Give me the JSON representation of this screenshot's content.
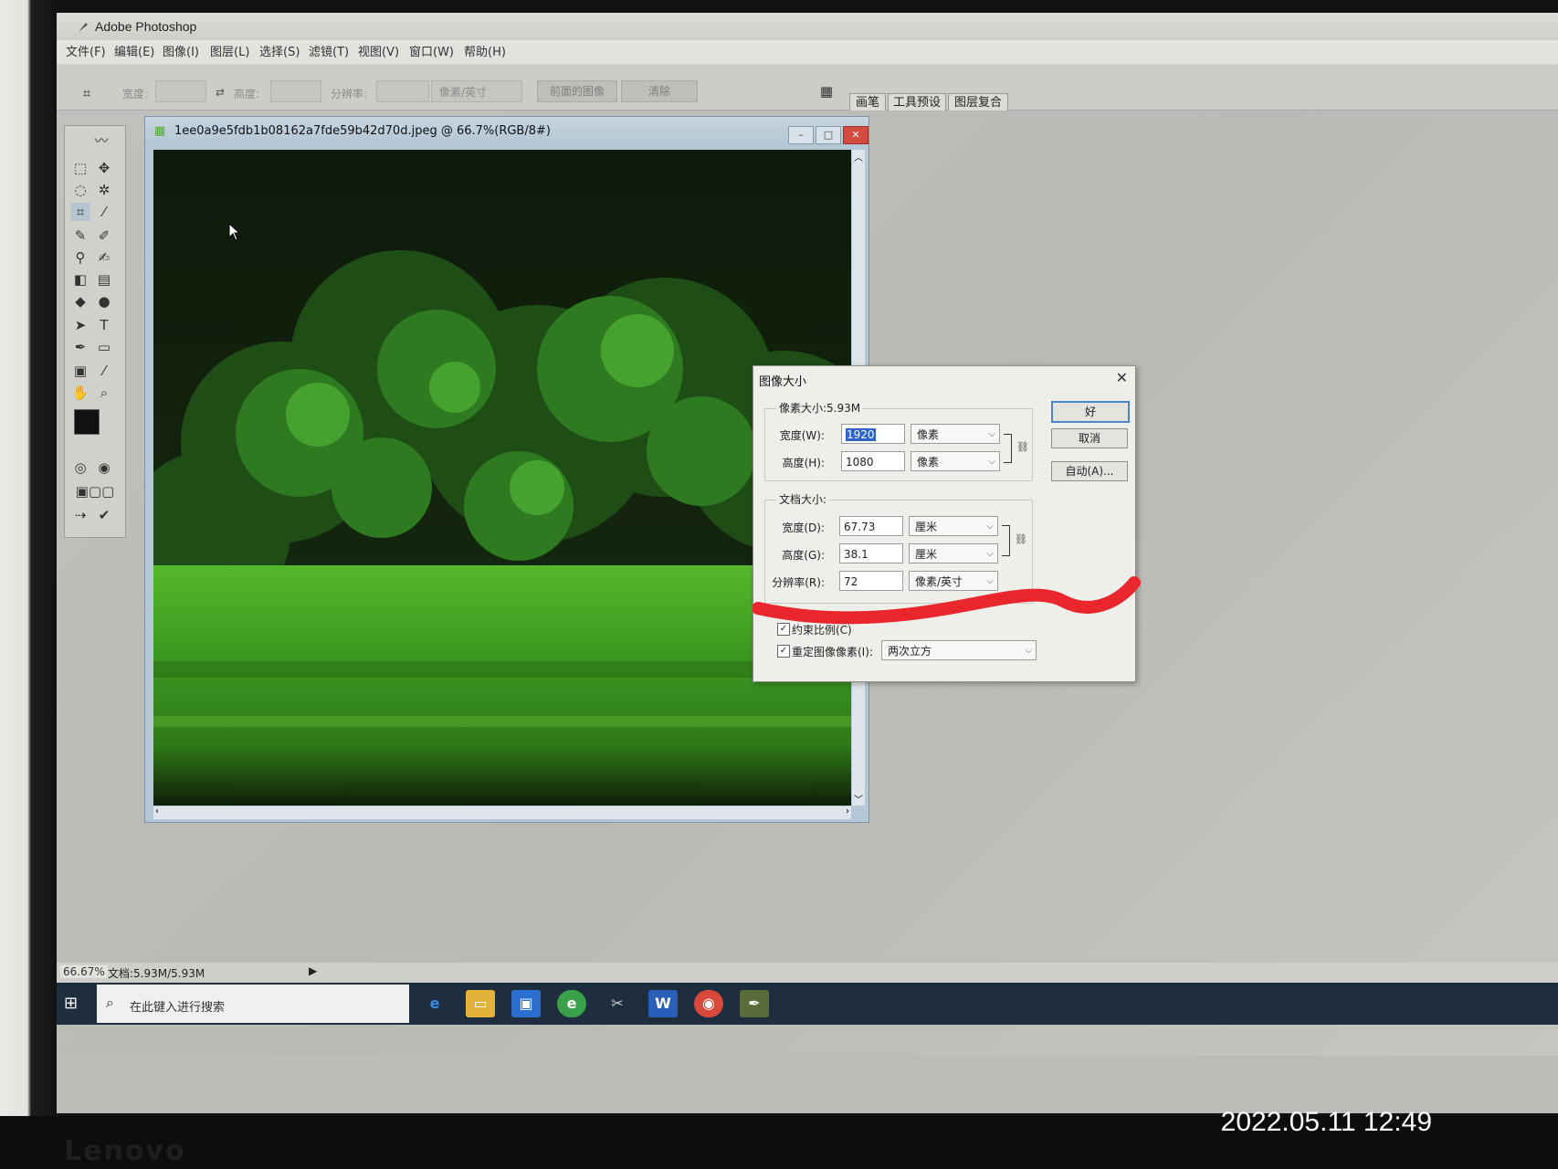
{
  "app": {
    "title": "Adobe Photoshop"
  },
  "menu": [
    "文件(F)",
    "编辑(E)",
    "图像(I)",
    "图层(L)",
    "选择(S)",
    "滤镜(T)",
    "视图(V)",
    "窗口(W)",
    "帮助(H)"
  ],
  "options": {
    "width_label": "宽度:",
    "height_label": "高度:",
    "resolution_label": "分辨率:",
    "unit_select": "像素/英寸",
    "front_image_button": "前面的图像",
    "clear_button": "清除"
  },
  "palette_tabs": [
    "画笔",
    "工具预设",
    "图层复合"
  ],
  "document": {
    "title": "1ee0a9e5fdb1b08162a7fde59b42d70d.jpeg @ 66.7%(RGB/8#)"
  },
  "dialog": {
    "title": "图像大小",
    "pixel_dimensions_label": "像素大小:5.93M",
    "width_label": "宽度(W):",
    "width_value": "1920",
    "width_unit": "像素",
    "height_label": "高度(H):",
    "height_value": "1080",
    "height_unit": "像素",
    "document_size_label": "文档大小:",
    "doc_width_label": "宽度(D):",
    "doc_width_value": "67.73",
    "doc_width_unit": "厘米",
    "doc_height_label": "高度(G):",
    "doc_height_value": "38.1",
    "doc_height_unit": "厘米",
    "resolution_label": "分辨率(R):",
    "resolution_value": "72",
    "resolution_unit": "像素/英寸",
    "constrain_label": "约束比例(C)",
    "constrain_checked": true,
    "resample_label": "重定图像像素(I):",
    "resample_checked": true,
    "resample_method": "两次立方",
    "ok_button": "好",
    "cancel_button": "取消",
    "auto_button": "自动(A)..."
  },
  "status": {
    "zoom": "66.67%",
    "doc_size": "文档:5.93M/5.93M"
  },
  "taskbar": {
    "search_placeholder": "在此键入进行搜索"
  },
  "photo_timestamp": "2022.05.11 12:49",
  "colors": {
    "accent": "#4f84c9",
    "annotation_red": "#e8262c",
    "selection": "#2d64c8"
  }
}
